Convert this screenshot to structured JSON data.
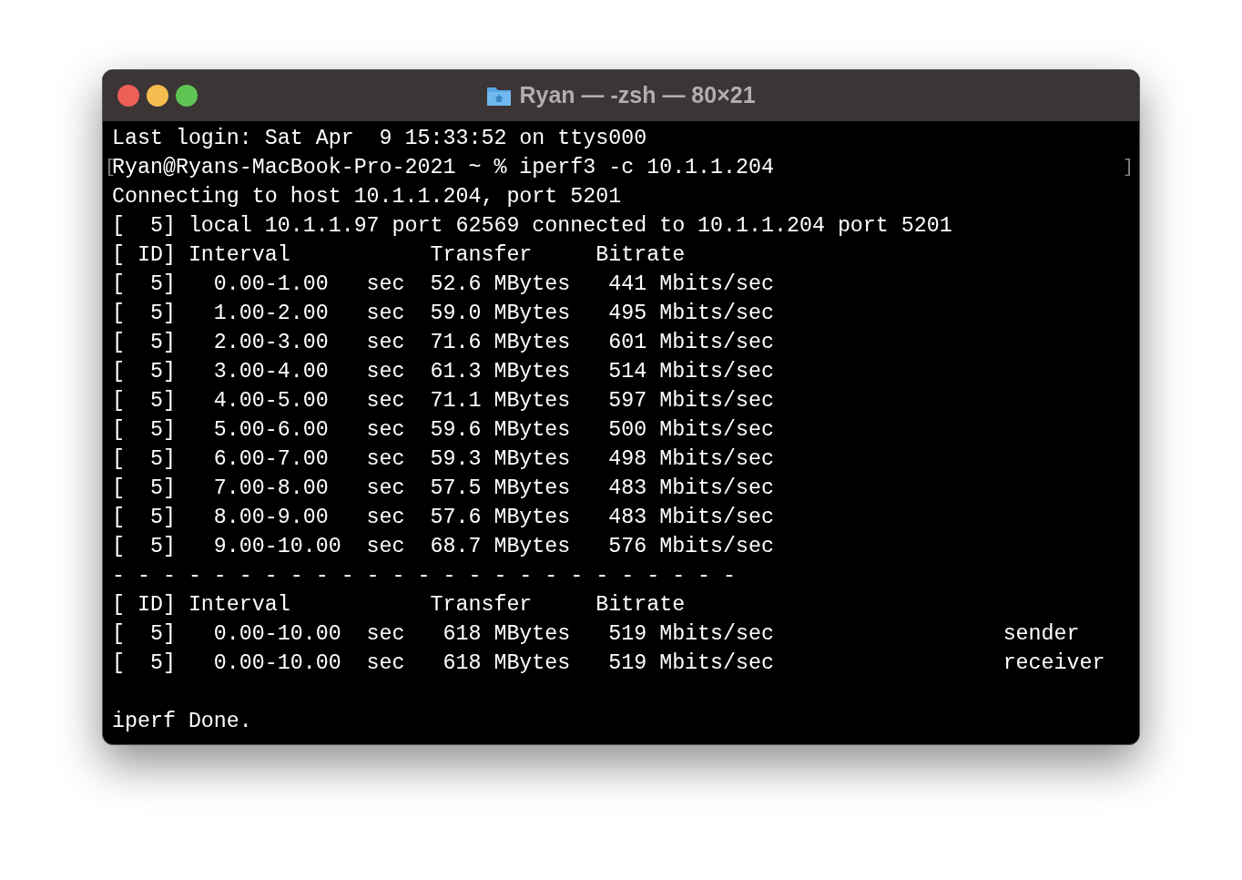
{
  "window": {
    "title": "Ryan — -zsh — 80×21"
  },
  "lines": [
    {
      "text": "Last login: Sat Apr  9 15:33:52 on ttys000"
    },
    {
      "text": "Ryan@Ryans-MacBook-Pro-2021 ~ % iperf3 -c 10.1.1.204",
      "mark_left": "[",
      "mark_right": "]"
    },
    {
      "text": "Connecting to host 10.1.1.204, port 5201"
    },
    {
      "text": "[  5] local 10.1.1.97 port 62569 connected to 10.1.1.204 port 5201"
    },
    {
      "text": "[ ID] Interval           Transfer     Bitrate"
    },
    {
      "text": "[  5]   0.00-1.00   sec  52.6 MBytes   441 Mbits/sec"
    },
    {
      "text": "[  5]   1.00-2.00   sec  59.0 MBytes   495 Mbits/sec"
    },
    {
      "text": "[  5]   2.00-3.00   sec  71.6 MBytes   601 Mbits/sec"
    },
    {
      "text": "[  5]   3.00-4.00   sec  61.3 MBytes   514 Mbits/sec"
    },
    {
      "text": "[  5]   4.00-5.00   sec  71.1 MBytes   597 Mbits/sec"
    },
    {
      "text": "[  5]   5.00-6.00   sec  59.6 MBytes   500 Mbits/sec"
    },
    {
      "text": "[  5]   6.00-7.00   sec  59.3 MBytes   498 Mbits/sec"
    },
    {
      "text": "[  5]   7.00-8.00   sec  57.5 MBytes   483 Mbits/sec"
    },
    {
      "text": "[  5]   8.00-9.00   sec  57.6 MBytes   483 Mbits/sec"
    },
    {
      "text": "[  5]   9.00-10.00  sec  68.7 MBytes   576 Mbits/sec"
    },
    {
      "text": "- - - - - - - - - - - - - - - - - - - - - - - - -"
    },
    {
      "text": "[ ID] Interval           Transfer     Bitrate"
    },
    {
      "text": "[  5]   0.00-10.00  sec   618 MBytes   519 Mbits/sec                  sender"
    },
    {
      "text": "[  5]   0.00-10.00  sec   618 MBytes   519 Mbits/sec                  receiver"
    },
    {
      "text": "iperf Done.",
      "blank_before": true
    }
  ]
}
